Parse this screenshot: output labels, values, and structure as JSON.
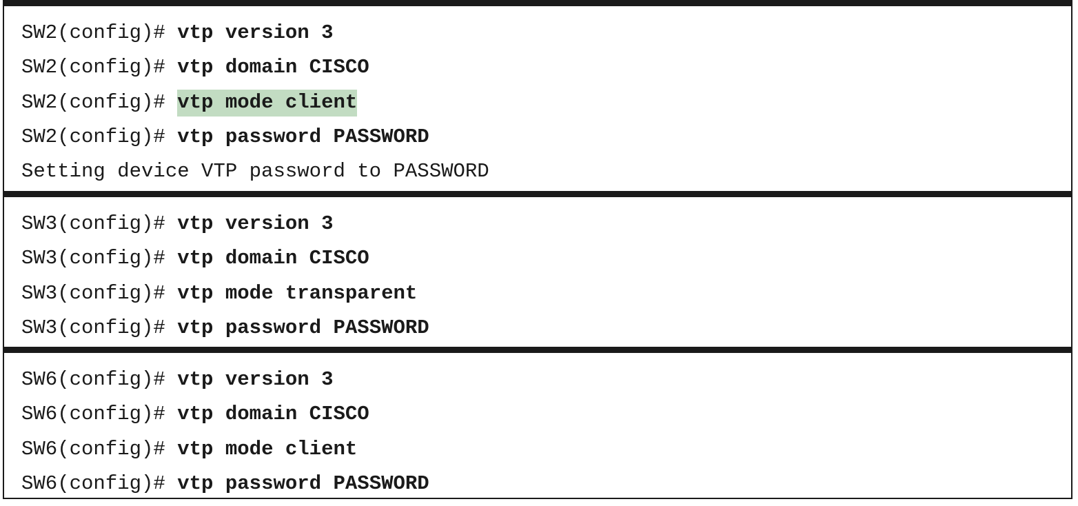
{
  "sections": [
    {
      "lines": [
        {
          "prompt": "SW2(config)# ",
          "command": "vtp version 3",
          "highlight": false
        },
        {
          "prompt": "SW2(config)# ",
          "command": "vtp domain CISCO",
          "highlight": false
        },
        {
          "prompt": "SW2(config)# ",
          "command": "vtp mode client",
          "highlight": true
        },
        {
          "prompt": "SW2(config)# ",
          "command": "vtp password PASSWORD",
          "highlight": false
        }
      ],
      "output": "Setting device VTP password to PASSWORD"
    },
    {
      "lines": [
        {
          "prompt": "SW3(config)# ",
          "command": "vtp version 3",
          "highlight": false
        },
        {
          "prompt": "SW3(config)# ",
          "command": "vtp domain CISCO",
          "highlight": false
        },
        {
          "prompt": "SW3(config)# ",
          "command": "vtp mode transparent",
          "highlight": false
        },
        {
          "prompt": "SW3(config)# ",
          "command": "vtp password PASSWORD",
          "highlight": false
        }
      ]
    },
    {
      "lines": [
        {
          "prompt": "SW6(config)# ",
          "command": "vtp version 3",
          "highlight": false
        },
        {
          "prompt": "SW6(config)# ",
          "command": "vtp domain CISCO",
          "highlight": false
        },
        {
          "prompt": "SW6(config)# ",
          "command": "vtp mode client",
          "highlight": false
        },
        {
          "prompt": "SW6(config)# ",
          "command": "vtp password PASSWORD",
          "highlight": false
        }
      ]
    }
  ],
  "colors": {
    "text": "#1a1a1a",
    "rule": "#1a1a1a",
    "highlight": "#c2dcc2"
  }
}
